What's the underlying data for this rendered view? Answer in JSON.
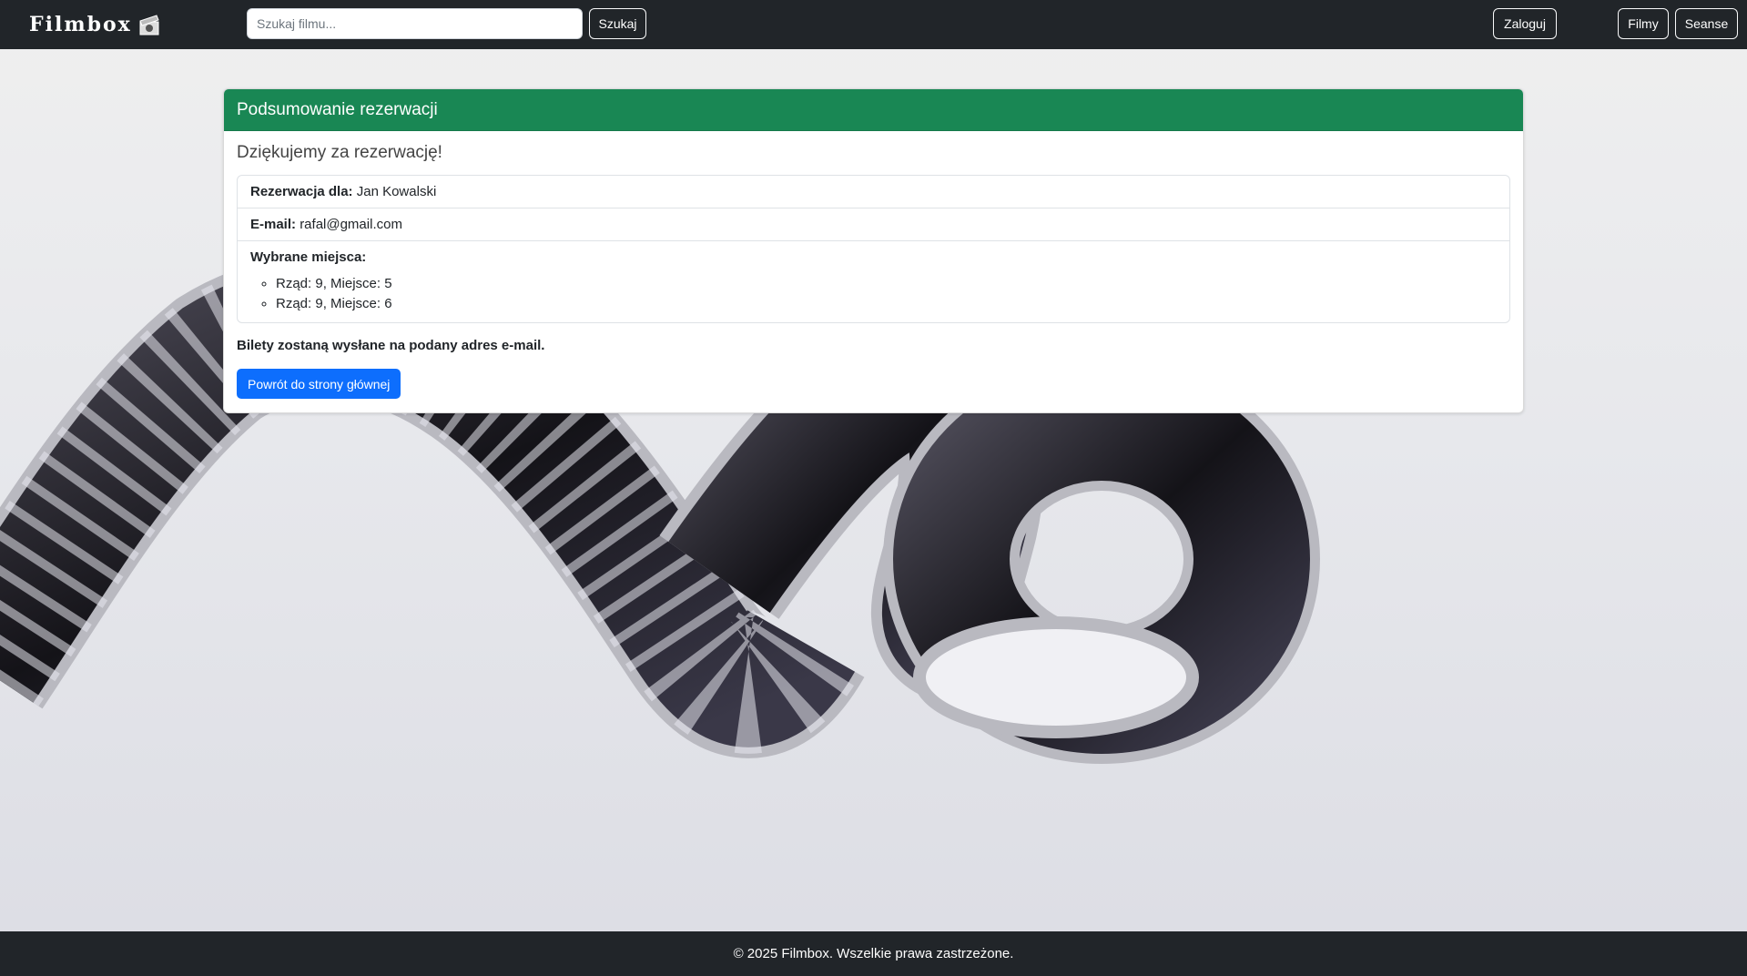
{
  "brand": {
    "name": "Filmbox"
  },
  "navbar": {
    "search_placeholder": "Szukaj filmu...",
    "search_button": "Szukaj",
    "login_button": "Zaloguj",
    "films_button": "Filmy",
    "sessions_button": "Seanse"
  },
  "summary": {
    "header": "Podsumowanie rezerwacji",
    "thanks": "Dziękujemy za rezerwację!",
    "reservation_label": "Rezerwacja dla:",
    "reservation_name": "Jan Kowalski",
    "email_label": "E-mail:",
    "email_value": "rafal@gmail.com",
    "seats_label": "Wybrane miejsca:",
    "seats": [
      "Rząd: 9, Miejsce: 5",
      "Rząd: 9, Miejsce: 6"
    ],
    "note": "Bilety zostaną wysłane na podany adres e-mail.",
    "back_button": "Powrót do strony głównej"
  },
  "footer": {
    "text": "© 2025 Filmbox. Wszelkie prawa zastrzeżone."
  },
  "colors": {
    "navbar": "#212529",
    "header_green": "#198754",
    "primary_blue": "#0d6efd"
  },
  "icons": {
    "logo": "film-clapper-icon"
  }
}
